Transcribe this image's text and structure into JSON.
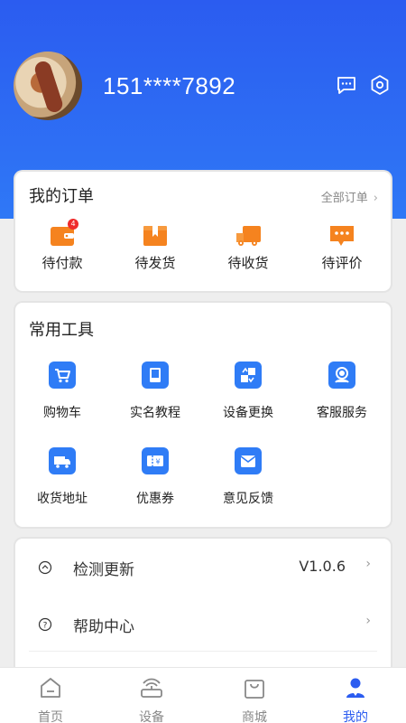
{
  "user": {
    "phone": "151****7892"
  },
  "header_icons": [
    "message-icon",
    "settings-icon"
  ],
  "orders": {
    "title": "我的订单",
    "all_label": "全部订单",
    "items": [
      {
        "label": "待付款",
        "icon": "wallet-icon",
        "badge": "4"
      },
      {
        "label": "待发货",
        "icon": "package-icon"
      },
      {
        "label": "待收货",
        "icon": "truck-icon"
      },
      {
        "label": "待评价",
        "icon": "comment-icon"
      }
    ]
  },
  "tools": {
    "title": "常用工具",
    "items": [
      {
        "label": "购物车",
        "icon": "cart-icon"
      },
      {
        "label": "实名教程",
        "icon": "book-icon"
      },
      {
        "label": "设备更换",
        "icon": "swap-icon"
      },
      {
        "label": "客服服务",
        "icon": "headset-icon"
      },
      {
        "label": "收货地址",
        "icon": "delivery-icon"
      },
      {
        "label": "优惠券",
        "icon": "coupon-icon"
      },
      {
        "label": "意见反馈",
        "icon": "mail-icon"
      }
    ]
  },
  "settings": [
    {
      "label": "检测更新",
      "value": "V1.0.6",
      "icon": "update-icon"
    },
    {
      "label": "帮助中心",
      "value": "",
      "icon": "help-icon"
    }
  ],
  "tabbar": [
    {
      "label": "首页",
      "icon": "home-icon"
    },
    {
      "label": "设备",
      "icon": "router-icon"
    },
    {
      "label": "商城",
      "icon": "shop-bag-icon"
    },
    {
      "label": "我的",
      "icon": "profile-icon",
      "active": true
    }
  ],
  "colors": {
    "primary": "#2b5cf0",
    "orange": "#f5831f",
    "tool_blue": "#2f7cf6",
    "badge": "#ef2b2b"
  }
}
